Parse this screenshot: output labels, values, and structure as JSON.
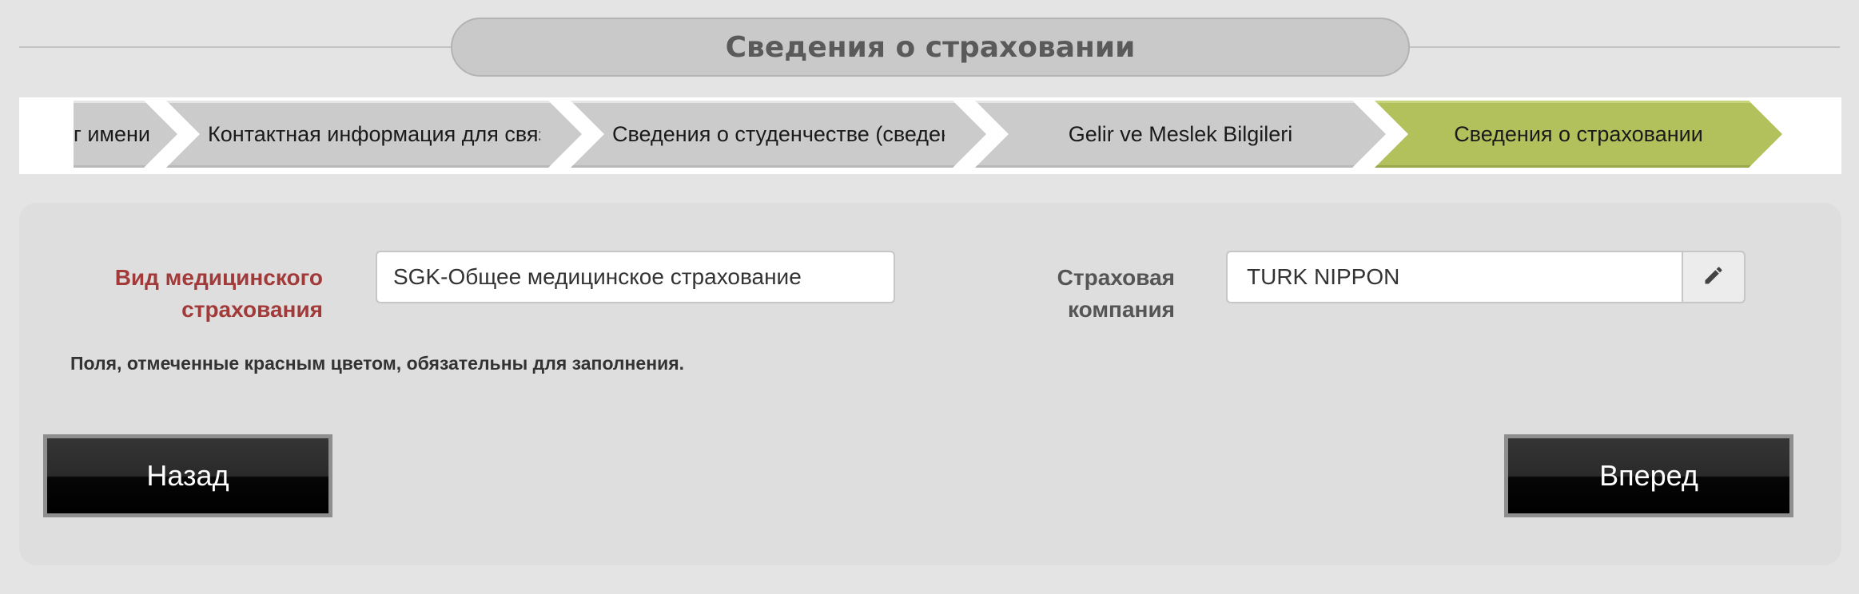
{
  "header": {
    "title": "Сведения о страховании"
  },
  "steps": [
    {
      "label": "г имени и",
      "active": false
    },
    {
      "label": "Контактная информация для связи в Турции",
      "active": false
    },
    {
      "label": "Сведения о студенчестве (сведения о текущем",
      "active": false
    },
    {
      "label": "Gelir ve Meslek Bilgileri",
      "active": false
    },
    {
      "label": "Сведения о страховании",
      "active": true
    }
  ],
  "form": {
    "insurance_type": {
      "label_line1": "Вид медицинского",
      "label_line2": "страхования",
      "value": "SGK-Общее медицинское страхование",
      "required": true
    },
    "insurance_company": {
      "label_line1": "Страховая",
      "label_line2": "компания",
      "value": "TURK NIPPON",
      "edit_icon": "pencil-icon",
      "required": false
    },
    "required_note": "Поля, отмеченные красным цветом, обязательны для заполнения."
  },
  "buttons": {
    "back": "Назад",
    "next": "Вперед"
  },
  "colors": {
    "active_step": "#b3c15c",
    "inactive_step": "#cbcbcb",
    "required_label": "#a33a3a",
    "page_background": "#e4e4e4"
  }
}
